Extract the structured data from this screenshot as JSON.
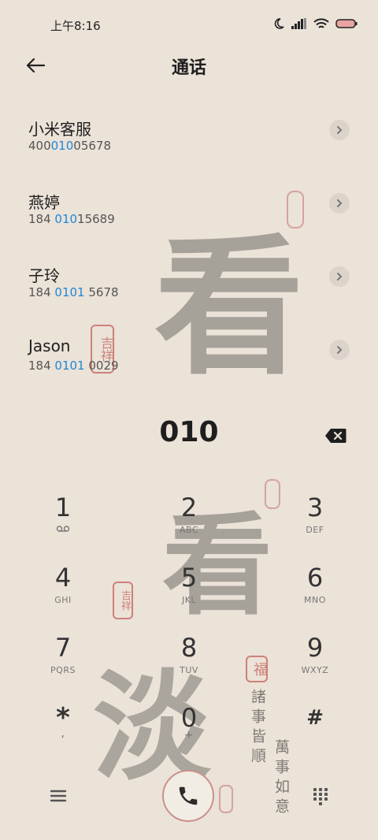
{
  "status": {
    "time": "上午8:16"
  },
  "header": {
    "title": "通话"
  },
  "contacts": [
    {
      "name": "小米客服",
      "num_pre": "400",
      "num_hl": "010",
      "num_post": "05678"
    },
    {
      "name": "燕婷",
      "num_pre": "184 ",
      "num_hl": "010",
      "num_post": "15689"
    },
    {
      "name": "子玲",
      "num_pre": "184 ",
      "num_hl": "0101",
      "num_post": " 5678"
    },
    {
      "name": "Jason",
      "num_pre": "184 ",
      "num_hl": "0101",
      "num_post": " 0029"
    }
  ],
  "dialer": {
    "digits": "010",
    "keys": [
      {
        "num": "1",
        "letters": ""
      },
      {
        "num": "2",
        "letters": "ABC"
      },
      {
        "num": "3",
        "letters": "DEF"
      },
      {
        "num": "4",
        "letters": "GHI"
      },
      {
        "num": "5",
        "letters": "JKL"
      },
      {
        "num": "6",
        "letters": "MNO"
      },
      {
        "num": "7",
        "letters": "PQRS"
      },
      {
        "num": "8",
        "letters": "TUV"
      },
      {
        "num": "9",
        "letters": "WXYZ"
      },
      {
        "num": "*",
        "letters": ","
      },
      {
        "num": "0",
        "letters": "+"
      },
      {
        "num": "#",
        "letters": ""
      }
    ]
  },
  "wallpaper": {
    "big_char_1": "看",
    "big_char_2": "看",
    "big_char_3": "淡",
    "seal_1": "吉祥",
    "seal_2": "吉祥",
    "seal_3": "福",
    "verse_1": "諸事皆順",
    "verse_2": "萬事如意"
  }
}
